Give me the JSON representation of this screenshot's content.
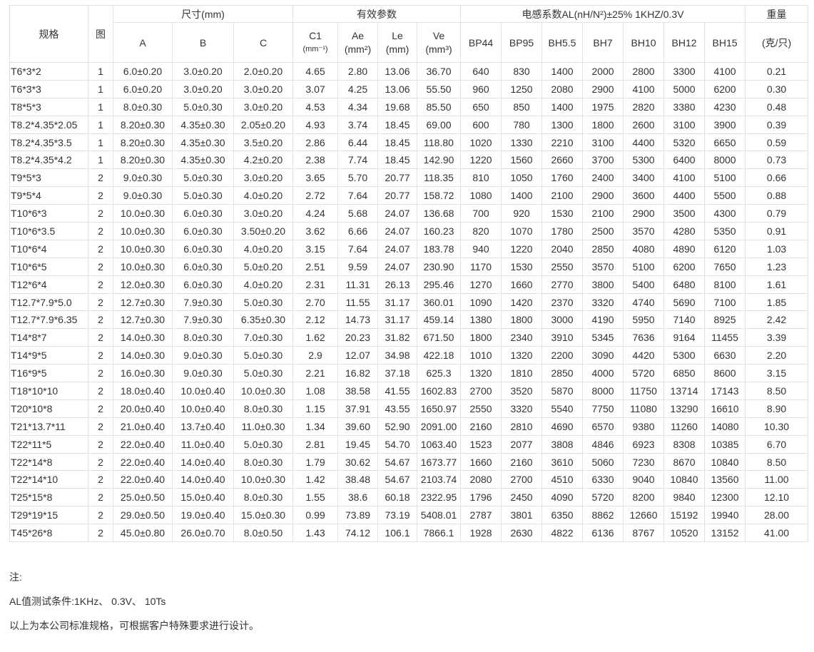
{
  "header": {
    "spec": "规格",
    "fig": "图",
    "dimensions": "尺寸(mm)",
    "effective_params": "有效参数",
    "inductance_coef": "电感系数AL(nH/N²)±25%  1KHZ/0.3V",
    "weight": "重量",
    "weight_unit": "(克/只)",
    "dim_cols": [
      "A",
      "B",
      "C"
    ],
    "param_cols": [
      {
        "name": "C1",
        "unit": "(mm⁻¹)"
      },
      {
        "name": "Ae",
        "unit": "(mm²)"
      },
      {
        "name": "Le",
        "unit": "(mm)"
      },
      {
        "name": "Ve",
        "unit": "(mm³)"
      }
    ],
    "material_cols": [
      "BP44",
      "BP95",
      "BH5.5",
      "BH7",
      "BH10",
      "BH12",
      "BH15"
    ]
  },
  "rows": [
    [
      "T6*3*2",
      "1",
      "6.0±0.20",
      "3.0±0.20",
      "2.0±0.20",
      "4.65",
      "2.80",
      "13.06",
      "36.70",
      "640",
      "830",
      "1400",
      "2000",
      "2800",
      "3300",
      "4100",
      "0.21"
    ],
    [
      "T6*3*3",
      "1",
      "6.0±0.20",
      "3.0±0.20",
      "3.0±0.20",
      "3.07",
      "4.25",
      "13.06",
      "55.50",
      "960",
      "1250",
      "2080",
      "2900",
      "4100",
      "5000",
      "6200",
      "0.30"
    ],
    [
      "T8*5*3",
      "1",
      "8.0±0.30",
      "5.0±0.30",
      "3.0±0.20",
      "4.53",
      "4.34",
      "19.68",
      "85.50",
      "650",
      "850",
      "1400",
      "1975",
      "2820",
      "3380",
      "4230",
      "0.48"
    ],
    [
      "T8.2*4.35*2.05",
      "1",
      "8.20±0.30",
      "4.35±0.30",
      "2.05±0.20",
      "4.93",
      "3.74",
      "18.45",
      "69.00",
      "600",
      "780",
      "1300",
      "1800",
      "2600",
      "3100",
      "3900",
      "0.39"
    ],
    [
      "T8.2*4.35*3.5",
      "1",
      "8.20±0.30",
      "4.35±0.30",
      "3.5±0.20",
      "2.86",
      "6.44",
      "18.45",
      "118.80",
      "1020",
      "1330",
      "2210",
      "3100",
      "4400",
      "5320",
      "6650",
      "0.59"
    ],
    [
      "T8.2*4.35*4.2",
      "1",
      "8.20±0.30",
      "4.35±0.30",
      "4.2±0.20",
      "2.38",
      "7.74",
      "18.45",
      "142.90",
      "1220",
      "1560",
      "2660",
      "3700",
      "5300",
      "6400",
      "8000",
      "0.73"
    ],
    [
      "T9*5*3",
      "2",
      "9.0±0.30",
      "5.0±0.30",
      "3.0±0.20",
      "3.65",
      "5.70",
      "20.77",
      "118.35",
      "810",
      "1050",
      "1760",
      "2400",
      "3400",
      "4100",
      "5100",
      "0.66"
    ],
    [
      "T9*5*4",
      "2",
      "9.0±0.30",
      "5.0±0.30",
      "4.0±0.20",
      "2.72",
      "7.64",
      "20.77",
      "158.72",
      "1080",
      "1400",
      "2100",
      "2900",
      "3600",
      "4400",
      "5500",
      "0.88"
    ],
    [
      "T10*6*3",
      "2",
      "10.0±0.30",
      "6.0±0.30",
      "3.0±0.20",
      "4.24",
      "5.68",
      "24.07",
      "136.68",
      "700",
      "920",
      "1530",
      "2100",
      "2900",
      "3500",
      "4300",
      "0.79"
    ],
    [
      "T10*6*3.5",
      "2",
      "10.0±0.30",
      "6.0±0.30",
      "3.50±0.20",
      "3.62",
      "6.66",
      "24.07",
      "160.23",
      "820",
      "1070",
      "1780",
      "2500",
      "3570",
      "4280",
      "5350",
      "0.91"
    ],
    [
      "T10*6*4",
      "2",
      "10.0±0.30",
      "6.0±0.30",
      "4.0±0.20",
      "3.15",
      "7.64",
      "24.07",
      "183.78",
      "940",
      "1220",
      "2040",
      "2850",
      "4080",
      "4890",
      "6120",
      "1.03"
    ],
    [
      "T10*6*5",
      "2",
      "10.0±0.30",
      "6.0±0.30",
      "5.0±0.20",
      "2.51",
      "9.59",
      "24.07",
      "230.90",
      "1170",
      "1530",
      "2550",
      "3570",
      "5100",
      "6200",
      "7650",
      "1.23"
    ],
    [
      "T12*6*4",
      "2",
      "12.0±0.30",
      "6.0±0.30",
      "4.0±0.20",
      "2.31",
      "11.31",
      "26.13",
      "295.46",
      "1270",
      "1660",
      "2770",
      "3800",
      "5400",
      "6480",
      "8100",
      "1.61"
    ],
    [
      "T12.7*7.9*5.0",
      "2",
      "12.7±0.30",
      "7.9±0.30",
      "5.0±0.30",
      "2.70",
      "11.55",
      "31.17",
      "360.01",
      "1090",
      "1420",
      "2370",
      "3320",
      "4740",
      "5690",
      "7100",
      "1.85"
    ],
    [
      "T12.7*7.9*6.35",
      "2",
      "12.7±0.30",
      "7.9±0.30",
      "6.35±0.30",
      "2.12",
      "14.73",
      "31.17",
      "459.14",
      "1380",
      "1800",
      "3000",
      "4190",
      "5950",
      "7140",
      "8925",
      "2.42"
    ],
    [
      "T14*8*7",
      "2",
      "14.0±0.30",
      "8.0±0.30",
      "7.0±0.30",
      "1.62",
      "20.23",
      "31.82",
      "671.50",
      "1800",
      "2340",
      "3910",
      "5345",
      "7636",
      "9164",
      "11455",
      "3.39"
    ],
    [
      "T14*9*5",
      "2",
      "14.0±0.30",
      "9.0±0.30",
      "5.0±0.30",
      "2.9",
      "12.07",
      "34.98",
      "422.18",
      "1010",
      "1320",
      "2200",
      "3090",
      "4420",
      "5300",
      "6630",
      "2.20"
    ],
    [
      "T16*9*5",
      "2",
      "16.0±0.30",
      "9.0±0.30",
      "5.0±0.30",
      "2.21",
      "16.82",
      "37.18",
      "625.3",
      "1320",
      "1810",
      "2850",
      "4000",
      "5720",
      "6850",
      "8600",
      "3.15"
    ],
    [
      "T18*10*10",
      "2",
      "18.0±0.40",
      "10.0±0.40",
      "10.0±0.30",
      "1.08",
      "38.58",
      "41.55",
      "1602.83",
      "2700",
      "3520",
      "5870",
      "8000",
      "11750",
      "13714",
      "17143",
      "8.50"
    ],
    [
      "T20*10*8",
      "2",
      "20.0±0.40",
      "10.0±0.40",
      "8.0±0.30",
      "1.15",
      "37.91",
      "43.55",
      "1650.97",
      "2550",
      "3320",
      "5540",
      "7750",
      "11080",
      "13290",
      "16610",
      "8.90"
    ],
    [
      "T21*13.7*11",
      "2",
      "21.0±0.40",
      "13.7±0.40",
      "11.0±0.30",
      "1.34",
      "39.60",
      "52.90",
      "2091.00",
      "2160",
      "2810",
      "4690",
      "6570",
      "9380",
      "11260",
      "14080",
      "10.30"
    ],
    [
      "T22*11*5",
      "2",
      "22.0±0.40",
      "11.0±0.40",
      "5.0±0.30",
      "2.81",
      "19.45",
      "54.70",
      "1063.40",
      "1523",
      "2077",
      "3808",
      "4846",
      "6923",
      "8308",
      "10385",
      "6.70"
    ],
    [
      "T22*14*8",
      "2",
      "22.0±0.40",
      "14.0±0.40",
      "8.0±0.30",
      "1.79",
      "30.62",
      "54.67",
      "1673.77",
      "1660",
      "2160",
      "3610",
      "5060",
      "7230",
      "8670",
      "10840",
      "8.50"
    ],
    [
      "T22*14*10",
      "2",
      "22.0±0.40",
      "14.0±0.40",
      "10.0±0.30",
      "1.42",
      "38.48",
      "54.67",
      "2103.74",
      "2080",
      "2700",
      "4510",
      "6330",
      "9040",
      "10840",
      "13560",
      "11.00"
    ],
    [
      "T25*15*8",
      "2",
      "25.0±0.50",
      "15.0±0.40",
      "8.0±0.30",
      "1.55",
      "38.6",
      "60.18",
      "2322.95",
      "1796",
      "2450",
      "4090",
      "5720",
      "8200",
      "9840",
      "12300",
      "12.10"
    ],
    [
      "T29*19*15",
      "2",
      "29.0±0.50",
      "19.0±0.40",
      "15.0±0.30",
      "0.99",
      "73.89",
      "73.19",
      "5408.01",
      "2787",
      "3801",
      "6350",
      "8862",
      "12660",
      "15192",
      "19940",
      "28.00"
    ],
    [
      "T45*26*8",
      "2",
      "45.0±0.80",
      "26.0±0.70",
      "8.0±0.50",
      "1.43",
      "74.12",
      "106.1",
      "7866.1",
      "1928",
      "2630",
      "4822",
      "6136",
      "8767",
      "10520",
      "13152",
      "41.00"
    ]
  ],
  "notes": {
    "title": "注:",
    "test_condition": "AL值测试条件:1KHz、 0.3V、 10Ts",
    "remark": "以上为本公司标准规格，可根据客户特殊要求进行设计。"
  },
  "colors": {
    "text": "#333333",
    "border": "#e2e2e2",
    "background": "#ffffff"
  }
}
